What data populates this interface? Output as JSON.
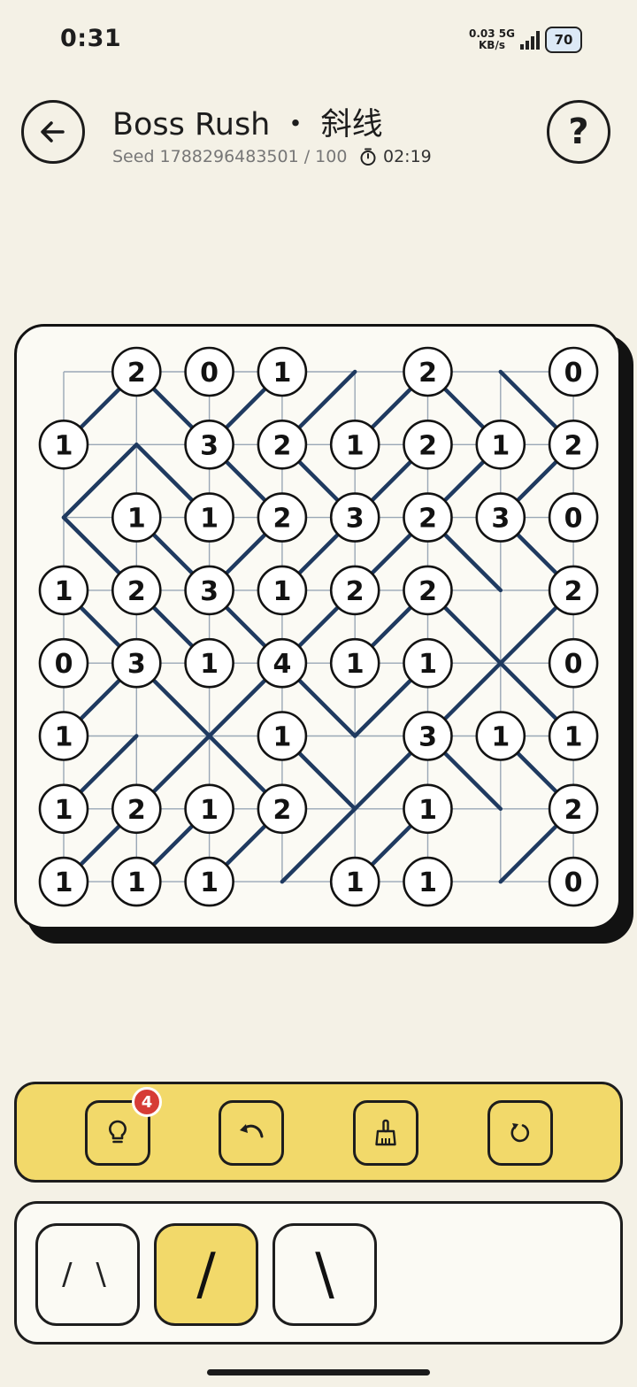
{
  "status": {
    "time": "0:31",
    "net_speed": "0.03",
    "net_unit": "KB/s",
    "net_type": "5G",
    "battery": "70"
  },
  "header": {
    "title": "Boss Rush ・ 斜线",
    "seed": "Seed 1788296483501 / 100",
    "timer": "02:19",
    "back_icon": "arrow-left-icon",
    "help_label": "?"
  },
  "board": {
    "grid_size": 7,
    "clues": [
      [
        "",
        "2",
        "0",
        "1",
        "",
        "2",
        "",
        "0"
      ],
      [
        "1",
        "",
        "3",
        "2",
        "1",
        "2",
        "1",
        "2"
      ],
      [
        "",
        "1",
        "1",
        "2",
        "3",
        "2",
        "3",
        "0"
      ],
      [
        "1",
        "2",
        "3",
        "1",
        "2",
        "2",
        "",
        "2"
      ],
      [
        "0",
        "3",
        "1",
        "4",
        "1",
        "1",
        "",
        "0"
      ],
      [
        "1",
        "",
        "",
        "1",
        "",
        "3",
        "1",
        "1"
      ],
      [
        "1",
        "2",
        "1",
        "2",
        "",
        "1",
        "",
        "2"
      ],
      [
        "1",
        "1",
        "1",
        "",
        "1",
        "1",
        "",
        "0"
      ]
    ],
    "slashes": [
      [
        "/",
        "\\",
        "/",
        "/",
        "/",
        "\\",
        "\\"
      ],
      [
        "/",
        "\\",
        "\\",
        "\\",
        "/",
        "/",
        "/"
      ],
      [
        "\\",
        "\\",
        "/",
        "/",
        "/",
        "\\",
        "\\"
      ],
      [
        "\\",
        "\\",
        "\\",
        "/",
        "/",
        "\\",
        "/"
      ],
      [
        "/",
        "\\",
        "/",
        "\\",
        "/",
        "/",
        "\\"
      ],
      [
        "/",
        "/",
        "\\",
        "\\",
        "/",
        "\\",
        "\\"
      ],
      [
        "/",
        "/",
        "/",
        "/",
        "/",
        "",
        "/"
      ]
    ],
    "line_color": "#1f3a60",
    "grid_color": "#9aa7b6"
  },
  "toolbar": {
    "hint_icon": "lightbulb-icon",
    "hint_count": "4",
    "undo_icon": "undo-icon",
    "clear_icon": "broom-icon",
    "restart_icon": "restart-icon",
    "accent": "#f2d96a"
  },
  "modes": [
    {
      "label": "/ \\",
      "active": false
    },
    {
      "label": "/",
      "active": true
    },
    {
      "label": "\\",
      "active": false
    }
  ]
}
